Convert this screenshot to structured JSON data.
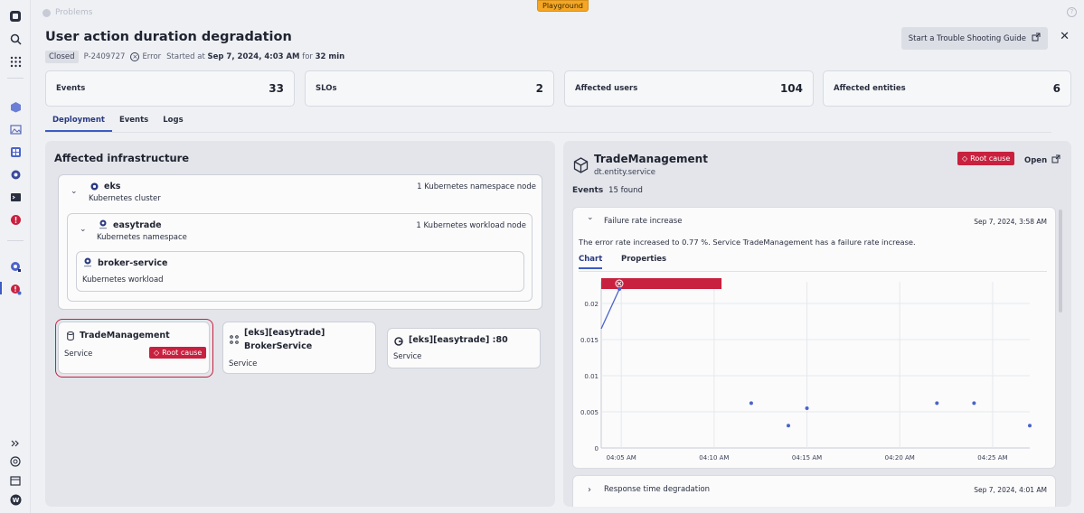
{
  "app": {
    "breadcrumb": "Problems",
    "environment_badge": "Playground"
  },
  "problem": {
    "title": "User action duration degradation",
    "status": "Closed",
    "id": "P-2409727",
    "severity": "Error",
    "started_prefix": "Started at",
    "started_at": "Sep 7, 2024, 4:03 AM",
    "for_word": "for",
    "duration": "32 min"
  },
  "actions": {
    "trouble_guide": "Start a Trouble Shooting Guide"
  },
  "stats": [
    {
      "label": "Events",
      "value": "33"
    },
    {
      "label": "SLOs",
      "value": "2"
    },
    {
      "label": "Affected users",
      "value": "104"
    },
    {
      "label": "Affected entities",
      "value": "6"
    }
  ],
  "tabs": [
    "Deployment",
    "Events",
    "Logs"
  ],
  "infrastructure": {
    "title": "Affected infrastructure",
    "cluster": {
      "name": "eks",
      "type": "Kubernetes cluster",
      "info": "1 Kubernetes namespace node"
    },
    "namespace": {
      "name": "easytrade",
      "type": "Kubernetes namespace",
      "info": "1 Kubernetes workload node"
    },
    "workload": {
      "name": "broker-service",
      "type": "Kubernetes workload"
    },
    "services": [
      {
        "name": "TradeManagement",
        "type": "Service",
        "badge": "Root cause"
      },
      {
        "name_line1": "[eks][easytrade]",
        "name_line2": "BrokerService",
        "type": "Service"
      },
      {
        "name": "[eks][easytrade] :80",
        "type": "Service"
      }
    ]
  },
  "entity": {
    "name": "TradeManagement",
    "id": "dt.entity.service",
    "badge": "Root cause",
    "open_label": "Open",
    "events_label": "Events",
    "events_count": "15 found"
  },
  "events": [
    {
      "title": "Failure rate increase",
      "time": "Sep 7, 2024, 3:58 AM",
      "description": "The error rate increased to 0.77 %. Service TradeManagement has a failure rate increase.",
      "tabs": [
        "Chart",
        "Properties"
      ]
    },
    {
      "title": "Response time degradation",
      "time": "Sep 7, 2024, 4:01 AM"
    }
  ],
  "colors": {
    "accent": "#3b5cc4",
    "root_cause": "#c8213f",
    "point": "#4b63c9"
  },
  "chart_data": {
    "type": "scatter",
    "x_ticks": [
      "04:05 AM",
      "04:10 AM",
      "04:15 AM",
      "04:20 AM",
      "04:25 AM"
    ],
    "y_ticks": [
      "0.02",
      "0.015",
      "0.01",
      "0.005",
      "0"
    ],
    "ylim": [
      0,
      0.023
    ],
    "xlim_minutes": [
      3.92,
      27.0
    ],
    "series": [
      {
        "values": [
          {
            "x": 3.92,
            "y": 0.0165
          },
          {
            "x": 4.9,
            "y": 0.022
          },
          {
            "x": 12.0,
            "y": 0.0062
          },
          {
            "x": 14.0,
            "y": 0.0031
          },
          {
            "x": 15.0,
            "y": 0.0055
          },
          {
            "x": 22.0,
            "y": 0.0062
          },
          {
            "x": 24.0,
            "y": 0.0062
          },
          {
            "x": 27.0,
            "y": 0.0031
          }
        ]
      }
    ],
    "line_segment_points": 2,
    "event_band_minutes": [
      3.92,
      10.4
    ]
  }
}
